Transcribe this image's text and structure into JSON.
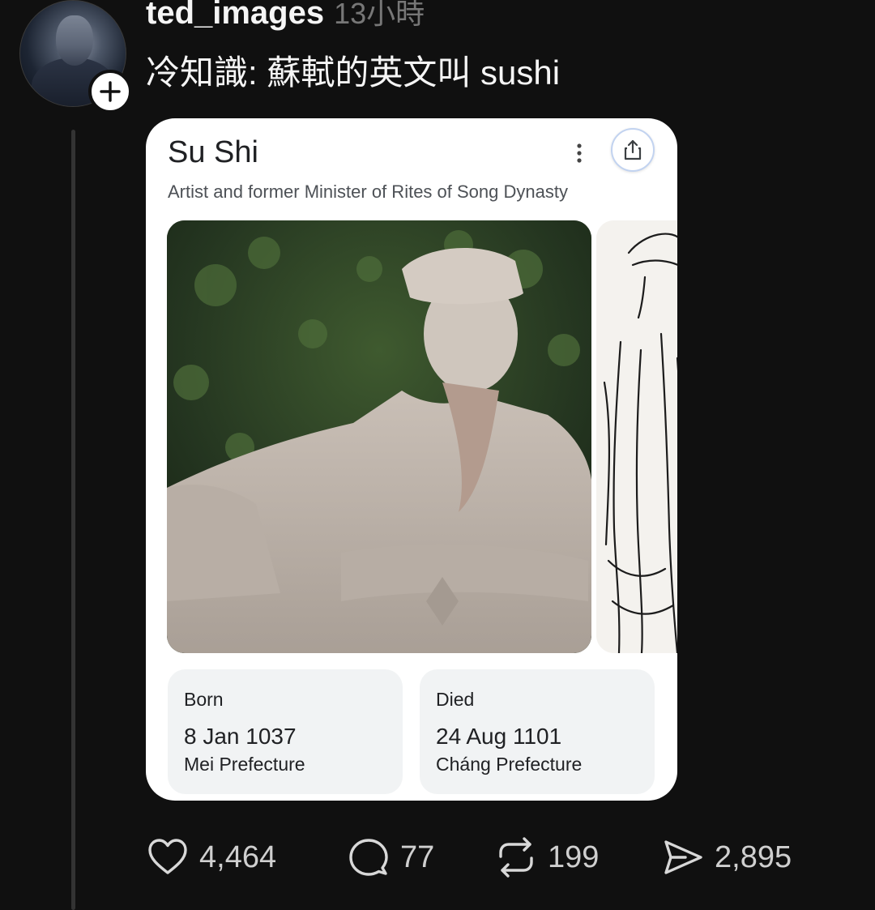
{
  "post": {
    "username": "ted_images",
    "timestamp": "13小時",
    "text": "冷知識: 蘇軾的英文叫 sushi"
  },
  "card": {
    "title": "Su Shi",
    "subtitle": "Artist and former Minister of Rites of Song Dynasty",
    "born": {
      "label": "Born",
      "date": "8 Jan 1037",
      "place": "Mei Prefecture"
    },
    "died": {
      "label": "Died",
      "date": "24 Aug 1101",
      "place": "Cháng Prefecture"
    }
  },
  "actions": {
    "likes": "4,464",
    "replies": "77",
    "reposts": "199",
    "shares": "2,895"
  },
  "icons": {
    "follow": "plus-icon",
    "more": "more-vertical-icon",
    "share_card": "share-icon",
    "like": "heart-icon",
    "reply": "speech-bubble-icon",
    "repost": "repost-icon",
    "send": "send-icon"
  },
  "colors": {
    "background": "#101010",
    "card_background": "#ffffff",
    "fact_background": "#f1f3f4",
    "muted_text": "#777777"
  }
}
